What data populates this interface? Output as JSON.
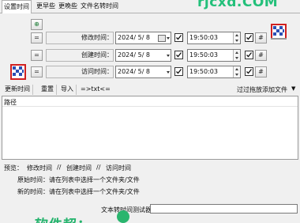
{
  "tabs": [
    {
      "label": "设置时间",
      "active": true
    },
    {
      "label": "更早些"
    },
    {
      "label": "更晚些"
    },
    {
      "label": "文件名转时间"
    }
  ],
  "watermark": "rjcxd.COM",
  "rows": [
    {
      "button": "=",
      "label": "修改时间：",
      "date": "2024/ 5/  8",
      "date_checked": true,
      "time": "19:50:03",
      "time_checked": true,
      "hash": "#"
    },
    {
      "button": "=",
      "label": "创建时间：",
      "date": "2024/ 5/  8",
      "date_checked": true,
      "time": "19:50:03",
      "time_checked": true,
      "hash": "#"
    },
    {
      "button": "=",
      "label": "访问时间：",
      "date": "2024/ 5/  8",
      "date_checked": true,
      "time": "19:50:03",
      "time_checked": true,
      "hash": "#"
    }
  ],
  "top_button": "⊕",
  "toolbar": {
    "update_time": "更新时间",
    "reset": "重置",
    "import": "导入",
    "convert": "=>txt<=",
    "skip_drop": "过过拖放添加文件",
    "skip_drop_arrow": "▼"
  },
  "list": {
    "header": "路径"
  },
  "preview": {
    "label": "预览：",
    "modified": "修改时间",
    "sep1": "//",
    "created": "创建时间",
    "sep2": "//",
    "accessed": "访问时间"
  },
  "info": {
    "original": "原始时间：请在列表中选择一个文件夹/文件",
    "new": "新的时间：请在列表中选择一个文件夹/文件"
  },
  "tester": {
    "label": "文本转时间测试器",
    "value": ""
  },
  "brand": "软件超：",
  "colors": {
    "accent_green": "#23c07a",
    "background": "#f0f0f0",
    "list_bg": "#ffffff"
  },
  "icons": {
    "calendar_icon": "calendar-icon",
    "app_icon": "red-blue-checker-icon"
  }
}
